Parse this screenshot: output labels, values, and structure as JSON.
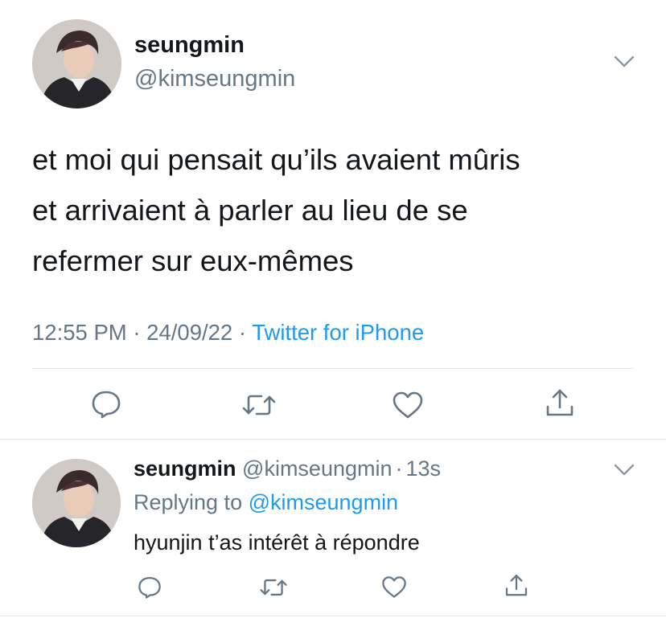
{
  "colors": {
    "text": "#14171a",
    "secondary": "#657786",
    "accent": "#1d9bf0",
    "divider": "#e1e8ed"
  },
  "main_tweet": {
    "display_name": "seungmin",
    "handle": "@kimseungmin",
    "text_lines": [
      "et moi qui pensait qu’ils avaient mûris",
      "et arrivaient à parler au lieu de se",
      "refermer sur eux-mêmes"
    ],
    "time": "12:55 PM",
    "date": "24/09/22",
    "separator": "·",
    "source": "Twitter for iPhone",
    "menu_icon": "chevron-down-icon"
  },
  "actions": {
    "reply_icon": "reply-icon",
    "retweet_icon": "retweet-icon",
    "like_icon": "heart-icon",
    "share_icon": "share-icon"
  },
  "reply_tweet": {
    "display_name": "seungmin",
    "handle": "@kimseungmin",
    "separator": "·",
    "age": "13s",
    "replying_to_label": "Replying to",
    "replying_to_handle": "@kimseungmin",
    "text": "hyunjin t’as intérêt à répondre",
    "menu_icon": "chevron-down-icon"
  }
}
